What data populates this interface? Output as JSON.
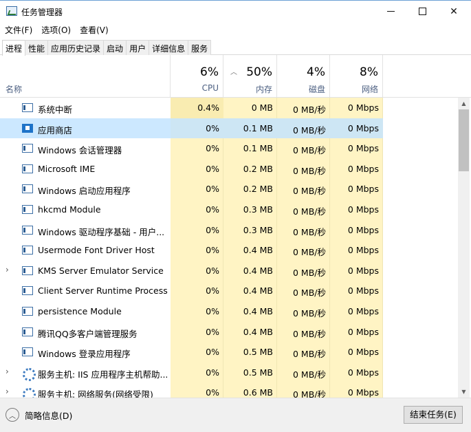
{
  "window": {
    "title": "任务管理器"
  },
  "menu": [
    "文件(F)",
    "选项(O)",
    "查看(V)"
  ],
  "tabs": [
    "进程",
    "性能",
    "应用历史记录",
    "启动",
    "用户",
    "详细信息",
    "服务"
  ],
  "active_tab": 0,
  "header": {
    "name_label": "名称",
    "cpu": {
      "pct": "6%",
      "label": "CPU"
    },
    "mem": {
      "pct": "50%",
      "label": "内存",
      "sorted": true
    },
    "disk": {
      "pct": "4%",
      "label": "磁盘"
    },
    "net": {
      "pct": "8%",
      "label": "网络"
    }
  },
  "processes": [
    {
      "name": "系统中断",
      "cpu": "0.4%",
      "mem": "0 MB",
      "disk": "0 MB/秒",
      "net": "0 Mbps",
      "icon": "window-icon",
      "expandable": false
    },
    {
      "name": "应用商店",
      "cpu": "0%",
      "mem": "0.1 MB",
      "disk": "0 MB/秒",
      "net": "0 Mbps",
      "icon": "store-icon",
      "expandable": false,
      "selected": true
    },
    {
      "name": "Windows 会话管理器",
      "cpu": "0%",
      "mem": "0.1 MB",
      "disk": "0 MB/秒",
      "net": "0 Mbps",
      "icon": "window-icon",
      "expandable": false
    },
    {
      "name": "Microsoft IME",
      "cpu": "0%",
      "mem": "0.2 MB",
      "disk": "0 MB/秒",
      "net": "0 Mbps",
      "icon": "window-icon",
      "expandable": false
    },
    {
      "name": "Windows 启动应用程序",
      "cpu": "0%",
      "mem": "0.2 MB",
      "disk": "0 MB/秒",
      "net": "0 Mbps",
      "icon": "window-icon",
      "expandable": false
    },
    {
      "name": "hkcmd Module",
      "cpu": "0%",
      "mem": "0.3 MB",
      "disk": "0 MB/秒",
      "net": "0 Mbps",
      "icon": "window-icon",
      "expandable": false
    },
    {
      "name": "Windows 驱动程序基础 - 用户...",
      "cpu": "0%",
      "mem": "0.3 MB",
      "disk": "0 MB/秒",
      "net": "0 Mbps",
      "icon": "window-icon",
      "expandable": false
    },
    {
      "name": "Usermode Font Driver Host",
      "cpu": "0%",
      "mem": "0.4 MB",
      "disk": "0 MB/秒",
      "net": "0 Mbps",
      "icon": "window-icon",
      "expandable": false
    },
    {
      "name": "KMS Server Emulator Service",
      "cpu": "0%",
      "mem": "0.4 MB",
      "disk": "0 MB/秒",
      "net": "0 Mbps",
      "icon": "window-icon",
      "expandable": true
    },
    {
      "name": "Client Server Runtime Process",
      "cpu": "0%",
      "mem": "0.4 MB",
      "disk": "0 MB/秒",
      "net": "0 Mbps",
      "icon": "window-icon",
      "expandable": false
    },
    {
      "name": "persistence Module",
      "cpu": "0%",
      "mem": "0.4 MB",
      "disk": "0 MB/秒",
      "net": "0 Mbps",
      "icon": "window-icon",
      "expandable": false
    },
    {
      "name": "腾讯QQ多客户端管理服务",
      "cpu": "0%",
      "mem": "0.4 MB",
      "disk": "0 MB/秒",
      "net": "0 Mbps",
      "icon": "window-icon",
      "expandable": false
    },
    {
      "name": "Windows 登录应用程序",
      "cpu": "0%",
      "mem": "0.5 MB",
      "disk": "0 MB/秒",
      "net": "0 Mbps",
      "icon": "window-icon",
      "expandable": false
    },
    {
      "name": "服务主机: IIS 应用程序主机帮助...",
      "cpu": "0%",
      "mem": "0.5 MB",
      "disk": "0 MB/秒",
      "net": "0 Mbps",
      "icon": "gear-icon",
      "expandable": true
    },
    {
      "name": "服务主机: 网络服务(网络受限)",
      "cpu": "0%",
      "mem": "0.6 MB",
      "disk": "0 MB/秒",
      "net": "0 Mbps",
      "icon": "gear-icon",
      "expandable": true
    }
  ],
  "footer": {
    "fewer_details": "简略信息(D)",
    "end_task": "结束任务(E)"
  },
  "colors": {
    "cell_light": "#fff4c4",
    "cell_cpu_high": "#f9ecb1",
    "selected_row": "#cce8ff",
    "header_label": "#4d6082"
  }
}
